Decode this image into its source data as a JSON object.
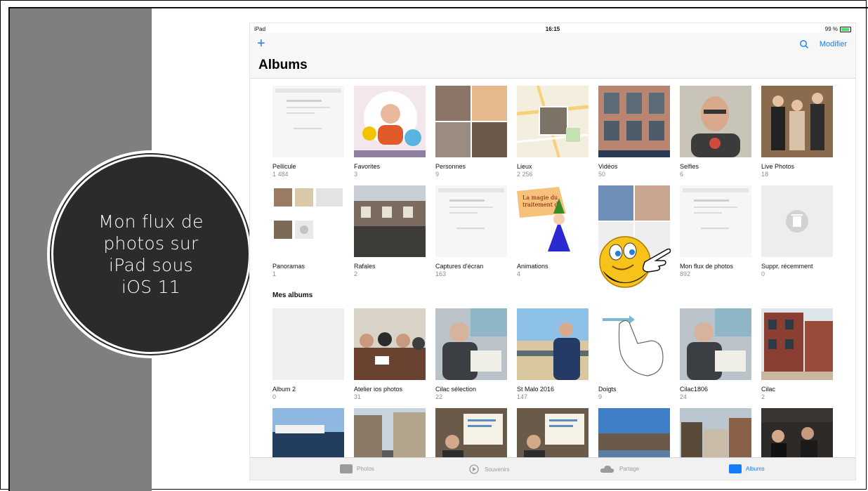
{
  "slide": {
    "badge_text": "Mon flux de\nphotos sur\niPad sous\niOS 11"
  },
  "statusbar": {
    "device": "iPad",
    "time": "16:15",
    "battery": "99 %"
  },
  "navbar": {
    "add_label": "+",
    "modify_label": "Modifier",
    "title": "Albums"
  },
  "albums": [
    {
      "label": "Pellicule",
      "count": "1 484",
      "art": "screen"
    },
    {
      "label": "Favorites",
      "count": "3",
      "art": "portrait"
    },
    {
      "label": "Personnes",
      "count": "9",
      "art": "faces"
    },
    {
      "label": "Lieux",
      "count": "2 256",
      "art": "map"
    },
    {
      "label": "Vidéos",
      "count": "50",
      "art": "building"
    },
    {
      "label": "Selfies",
      "count": "6",
      "art": "selfie"
    },
    {
      "label": "Live Photos",
      "count": "18",
      "art": "group"
    },
    {
      "label": "Panoramas",
      "count": "1",
      "art": "panel"
    },
    {
      "label": "Rafales",
      "count": "2",
      "art": "street"
    },
    {
      "label": "Captures d'écran",
      "count": "163",
      "art": "screen"
    },
    {
      "label": "Animations",
      "count": "4",
      "art": "wizard"
    },
    {
      "label": "",
      "count": "",
      "art": "faces2"
    },
    {
      "label": "Mon flux de photos",
      "count": "892",
      "art": "screen"
    },
    {
      "label": "Suppr. récemment",
      "count": "0",
      "art": "trash"
    }
  ],
  "my_albums_title": "Mes albums",
  "my_albums": [
    {
      "label": "Album 2",
      "count": "0",
      "art": "empty"
    },
    {
      "label": "Atelier ios photos",
      "count": "31",
      "art": "meeting"
    },
    {
      "label": "Cilac sélection",
      "count": "22",
      "art": "reader"
    },
    {
      "label": "St Malo 2016",
      "count": "147",
      "art": "beach"
    },
    {
      "label": "Doigts",
      "count": "9",
      "art": "finger"
    },
    {
      "label": "Cilac1806",
      "count": "24",
      "art": "reader"
    },
    {
      "label": "Cilac",
      "count": "2",
      "art": "brick"
    }
  ],
  "more_albums": [
    "ship",
    "street2",
    "present",
    "present",
    "canal",
    "houses",
    "party"
  ],
  "tabbar": {
    "photos": "Photos",
    "memories": "Souvenirs",
    "shared": "Partage",
    "albums": "Albums"
  },
  "colors": {
    "accent": "#147efb",
    "badge": "#2b2b2b",
    "band": "#7f7f7f"
  }
}
